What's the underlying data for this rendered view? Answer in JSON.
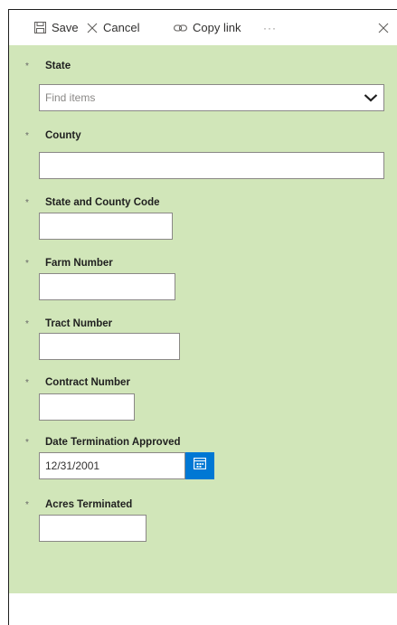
{
  "toolbar": {
    "save_label": "Save",
    "cancel_label": "Cancel",
    "copy_link_label": "Copy link",
    "more_label": "···",
    "icons": {
      "save": "save-icon",
      "cancel": "cancel-x-icon",
      "copy_link": "link-icon",
      "close": "close-icon"
    }
  },
  "form": {
    "background_color": "#d1e6b9",
    "required_marker": "*",
    "fields": {
      "state": {
        "label": "State",
        "placeholder": "Find items",
        "value": ""
      },
      "county": {
        "label": "County",
        "value": ""
      },
      "state_county_code": {
        "label": "State and County Code",
        "value": ""
      },
      "farm_number": {
        "label": "Farm Number",
        "value": ""
      },
      "tract_number": {
        "label": "Tract Number",
        "value": ""
      },
      "contract_number": {
        "label": "Contract Number",
        "value": ""
      },
      "date_termination_approved": {
        "label": "Date Termination Approved",
        "value": "12/31/2001"
      },
      "acres_terminated": {
        "label": "Acres Terminated",
        "value": ""
      }
    }
  },
  "colors": {
    "accent": "#0078d4",
    "form_bg": "#d1e6b9"
  }
}
